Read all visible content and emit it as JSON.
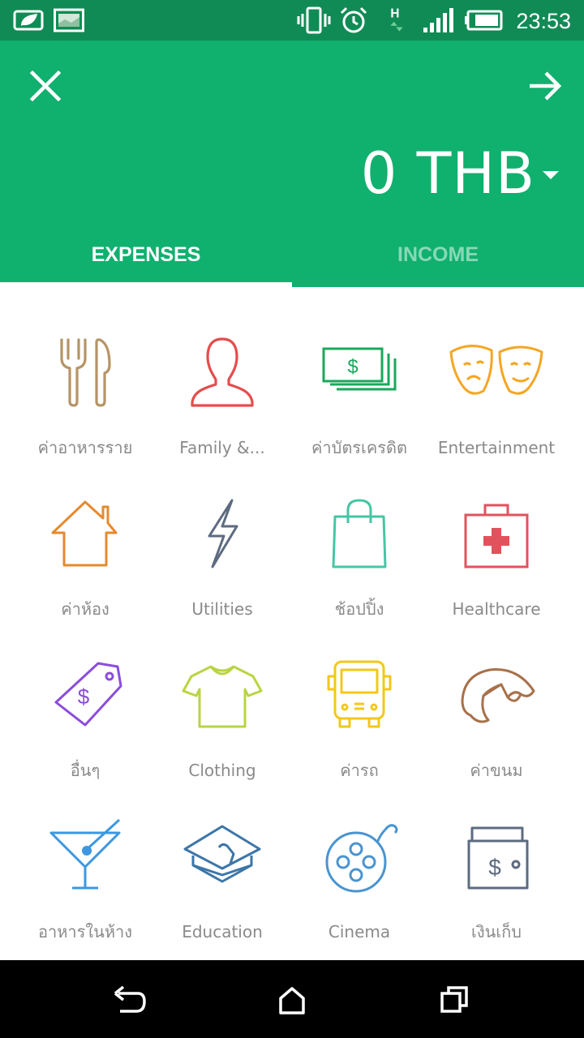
{
  "status_bar": {
    "time": "23:53",
    "icons": [
      "leaf-battery-saver-icon",
      "image-notification-icon",
      "vibrate-icon",
      "alarm-icon",
      "network-h-icon",
      "signal-icon",
      "battery-icon"
    ]
  },
  "header": {
    "close_icon": "close-icon",
    "next_icon": "arrow-right-icon",
    "amount": "0 THB",
    "background": "#10b06e"
  },
  "tabs": [
    {
      "label": "EXPENSES",
      "active": true
    },
    {
      "label": "INCOME",
      "active": false
    }
  ],
  "categories": [
    {
      "label": "ค่าอาหารราย",
      "icon": "fork-knife-icon",
      "color": "#b59466"
    },
    {
      "label": "Family &...",
      "icon": "person-icon",
      "color": "#e54d4d"
    },
    {
      "label": "ค่าบัตรเครดิต",
      "icon": "money-stack-icon",
      "color": "#1aa85c"
    },
    {
      "label": "Entertainment",
      "icon": "theater-masks-icon",
      "color": "#f5a623"
    },
    {
      "label": "ค่าห้อง",
      "icon": "house-icon",
      "color": "#e58a2e"
    },
    {
      "label": "Utilities",
      "icon": "lightning-icon",
      "color": "#5d6b80"
    },
    {
      "label": "ช้อปปิ้ง",
      "icon": "shopping-bag-icon",
      "color": "#45c6a5"
    },
    {
      "label": "Healthcare",
      "icon": "first-aid-kit-icon",
      "color": "#e0535d"
    },
    {
      "label": "อื่นๆ",
      "icon": "price-tag-icon",
      "color": "#8b4ddb"
    },
    {
      "label": "Clothing",
      "icon": "tshirt-icon",
      "color": "#b9d443"
    },
    {
      "label": "ค่ารถ",
      "icon": "bus-icon",
      "color": "#f2c81a"
    },
    {
      "label": "ค่าขนม",
      "icon": "croissant-icon",
      "color": "#a8714a"
    },
    {
      "label": "อาหารในห้าง",
      "icon": "cocktail-icon",
      "color": "#3b98e0"
    },
    {
      "label": "Education",
      "icon": "graduation-cap-icon",
      "color": "#3c76a8"
    },
    {
      "label": "Cinema",
      "icon": "film-reel-icon",
      "color": "#4a94d0"
    },
    {
      "label": "เงินเก็บ",
      "icon": "wallet-icon",
      "color": "#5d6b80"
    }
  ],
  "nav_bar": {
    "back_icon": "back-icon",
    "home_icon": "home-icon",
    "recents_icon": "recents-icon"
  }
}
